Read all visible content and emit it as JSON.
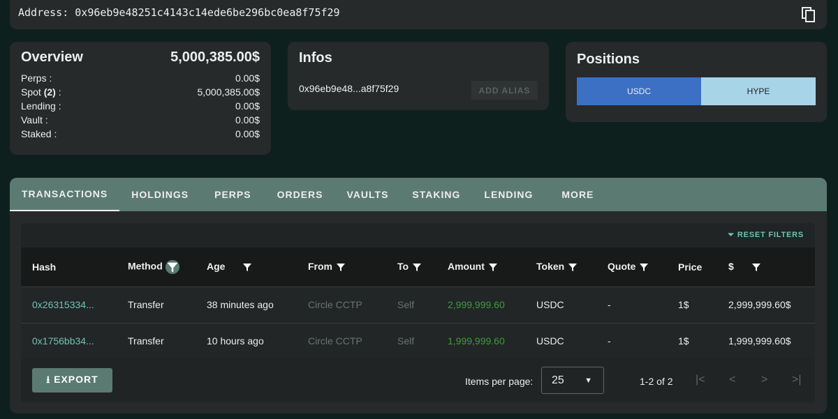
{
  "address": {
    "label": "Address:",
    "value": "0x96eb9e48251c4143c14ede6be296bc0ea8f75f29"
  },
  "overview": {
    "title": "Overview",
    "total": "5,000,385.00$",
    "rows": [
      {
        "label": "Perps :",
        "value": "0.00$"
      },
      {
        "label": "Spot",
        "count": "(2)",
        "suffix": " :",
        "value": "5,000,385.00$"
      },
      {
        "label": "Lending :",
        "value": "0.00$"
      },
      {
        "label": "Vault :",
        "value": "0.00$"
      },
      {
        "label": "Staked :",
        "value": "0.00$"
      }
    ]
  },
  "infos": {
    "title": "Infos",
    "short_address": "0x96eb9e48...a8f75f29",
    "add_alias": "ADD ALIAS"
  },
  "positions": {
    "title": "Positions",
    "items": [
      {
        "label": "USDC",
        "color": "#3b70c4"
      },
      {
        "label": "HYPE",
        "color": "#a8d4e8"
      }
    ]
  },
  "tabs": [
    "TRANSACTIONS",
    "HOLDINGS",
    "PERPS",
    "ORDERS",
    "VAULTS",
    "STAKING",
    "LENDING",
    "MORE"
  ],
  "reset_filters": "RESET FILTERS",
  "columns": [
    "Hash",
    "Method",
    "Age",
    "From",
    "To",
    "Amount",
    "Token",
    "Quote",
    "Price",
    "$"
  ],
  "rows": [
    [
      "0x26315334...",
      "Transfer",
      "38 minutes ago",
      "Circle CCTP",
      "Self",
      "2,999,999.60",
      "USDC",
      "-",
      "1$",
      "2,999,999.60$"
    ],
    [
      "0x1756bb34...",
      "Transfer",
      "10 hours ago",
      "Circle CCTP",
      "Self",
      "1,999,999.60",
      "USDC",
      "-",
      "1$",
      "1,999,999.60$"
    ]
  ],
  "footer": {
    "export": "EXPORT",
    "items_per_page_label": "Items per page:",
    "items_per_page": "25",
    "range": "1-2 of 2"
  }
}
